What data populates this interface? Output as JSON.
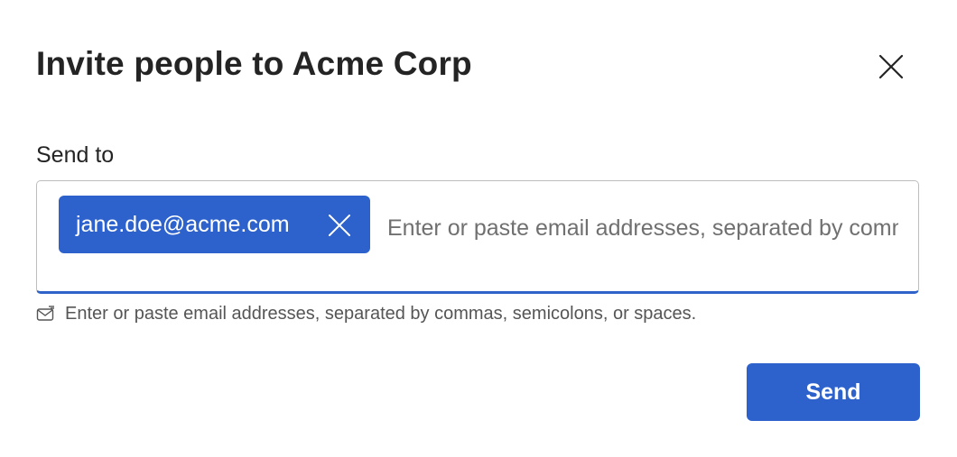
{
  "dialog": {
    "title": "Invite people to Acme Corp",
    "close_icon": "close-icon"
  },
  "form": {
    "send_to_label": "Send to",
    "recipients": [
      {
        "email": "jane.doe@acme.com",
        "remove_icon": "close-icon"
      }
    ],
    "input": {
      "value": "",
      "placeholder": "Enter or paste email addresses, separated by commas, semicolons, or spaces."
    },
    "helper": {
      "icon": "mail-icon",
      "text": "Enter or paste email addresses, separated by commas, semicolons, or spaces."
    }
  },
  "actions": {
    "send_label": "Send"
  },
  "colors": {
    "accent": "#2d62cc",
    "text": "#242424",
    "placeholder": "#707070",
    "border": "#bdbdbd"
  }
}
